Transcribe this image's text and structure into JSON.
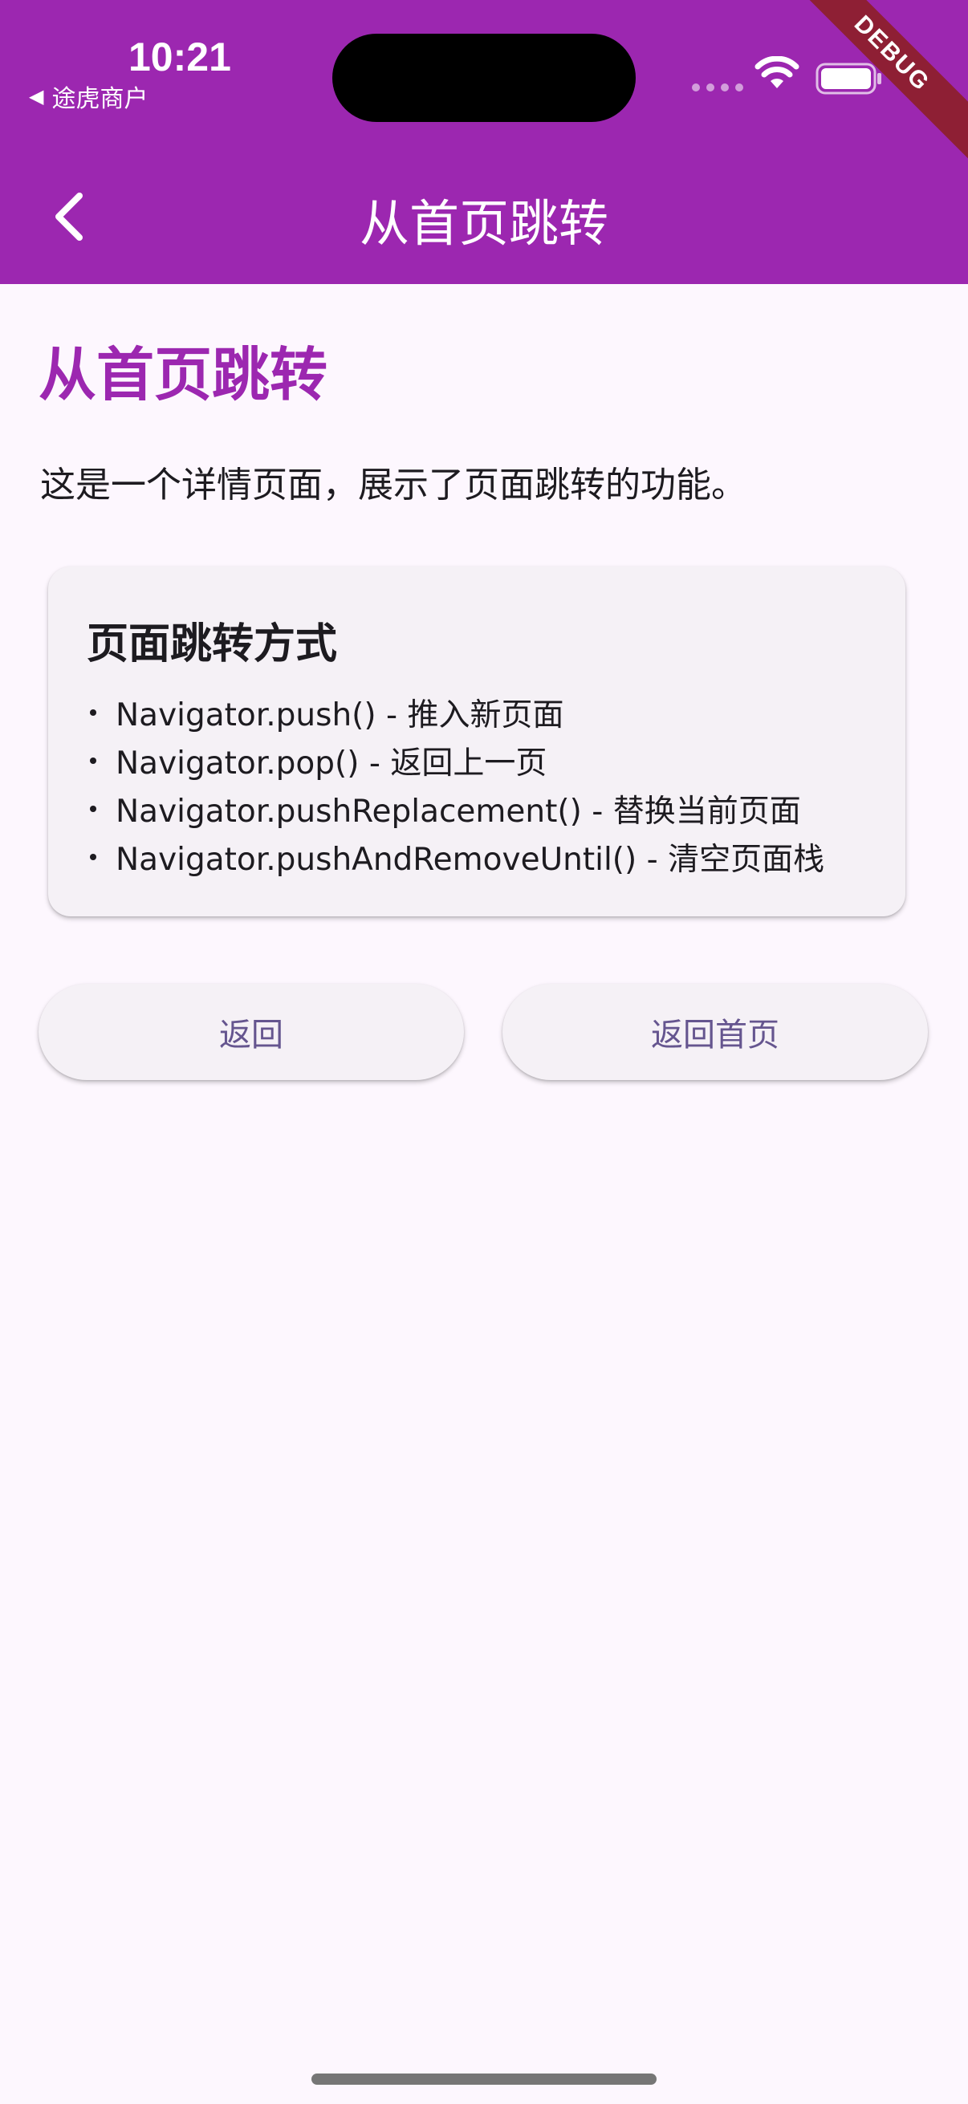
{
  "status_bar": {
    "time": "10:21",
    "back_app": "途虎商户",
    "back_glyph": "◀"
  },
  "debug_banner": "DEBUG",
  "app_bar": {
    "title": "从首页跳转",
    "back_icon": "chevron-left-icon"
  },
  "main": {
    "heading": "从首页跳转",
    "description": "这是一个详情页面，展示了页面跳转的功能。"
  },
  "card": {
    "title": "页面跳转方式",
    "items": [
      "Navigator.push() - 推入新页面",
      "Navigator.pop() - 返回上一页",
      "Navigator.pushReplacement() - 替换当前页面",
      "Navigator.pushAndRemoveUntil() - 清空页面栈"
    ]
  },
  "buttons": {
    "back": "返回",
    "home": "返回首页"
  },
  "colors": {
    "primary": "#9c27b0",
    "background": "#fdf7fe",
    "button_text": "#65558f",
    "debug_ribbon": "#8e1f34"
  }
}
